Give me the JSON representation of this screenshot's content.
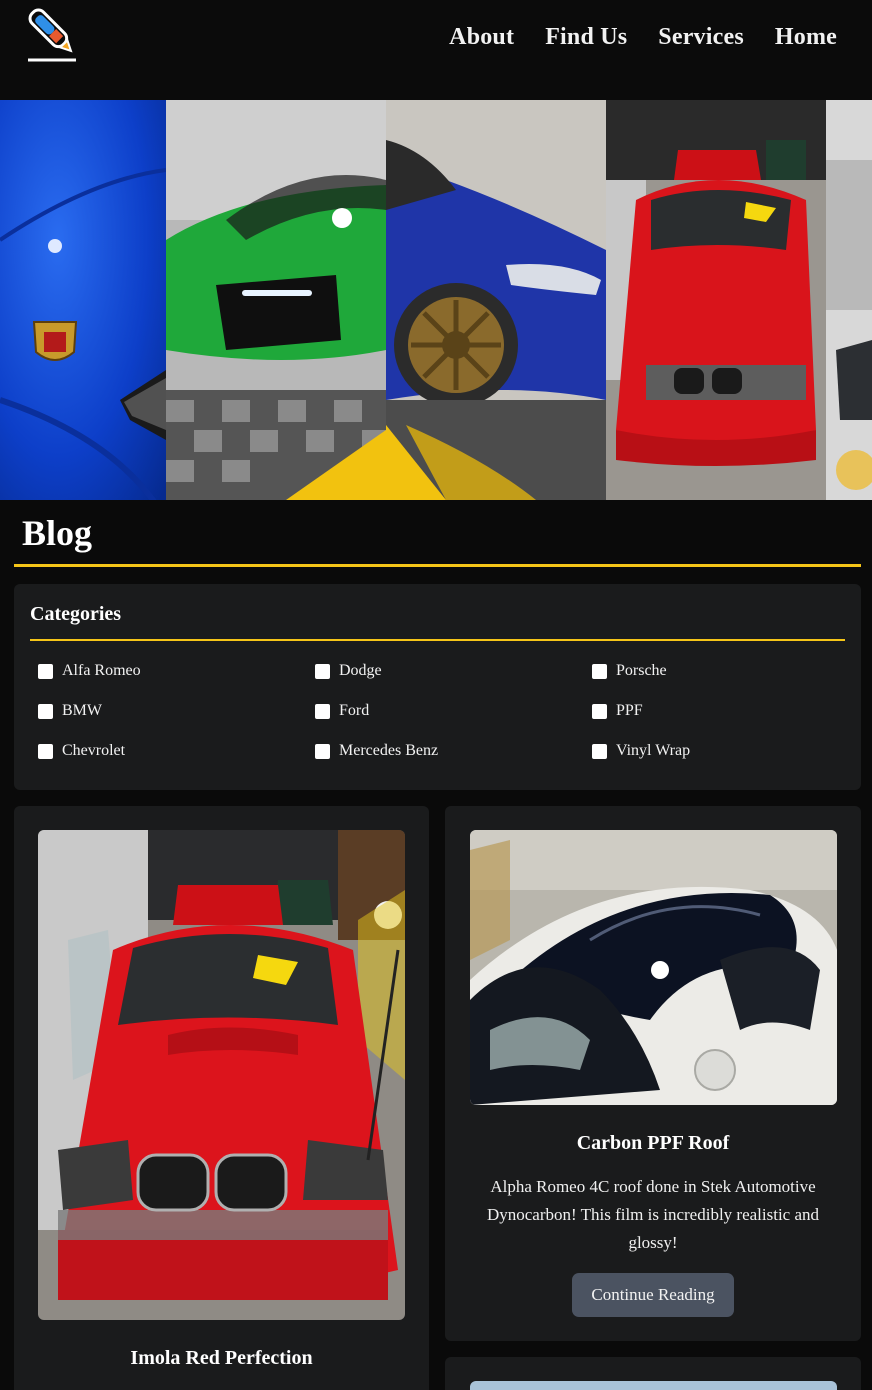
{
  "nav": {
    "logo_icon": "paint-pen-logo-icon",
    "links": [
      "About",
      "Find Us",
      "Services",
      "Home"
    ]
  },
  "hero": {
    "images": [
      "blue-porsche-badge",
      "green-porsche-front",
      "blue-bmw-wheel",
      "red-bmw-front",
      "silver-suv-edge"
    ]
  },
  "blog": {
    "title": "Blog"
  },
  "categories": {
    "heading": "Categories",
    "items": [
      "Alfa Romeo",
      "Dodge",
      "Porsche",
      "BMW",
      "Ford",
      "PPF",
      "Chevrolet",
      "Mercedes Benz",
      "Vinyl Wrap"
    ]
  },
  "posts": [
    {
      "title": "Imola Red Perfection",
      "image": "red-bmw-m3-in-garage"
    },
    {
      "title": "Carbon PPF Roof",
      "excerpt": "Alpha Romeo 4C roof done in Stek Automotive Dynocarbon! This film is incredibly realistic and glossy!",
      "button": "Continue Reading",
      "image": "carbon-roof-alfa-4c"
    }
  ],
  "colors": {
    "accent": "#f5c518",
    "card": "#1a1b1c",
    "button": "#4b5361",
    "background": "#0a0a0a"
  }
}
